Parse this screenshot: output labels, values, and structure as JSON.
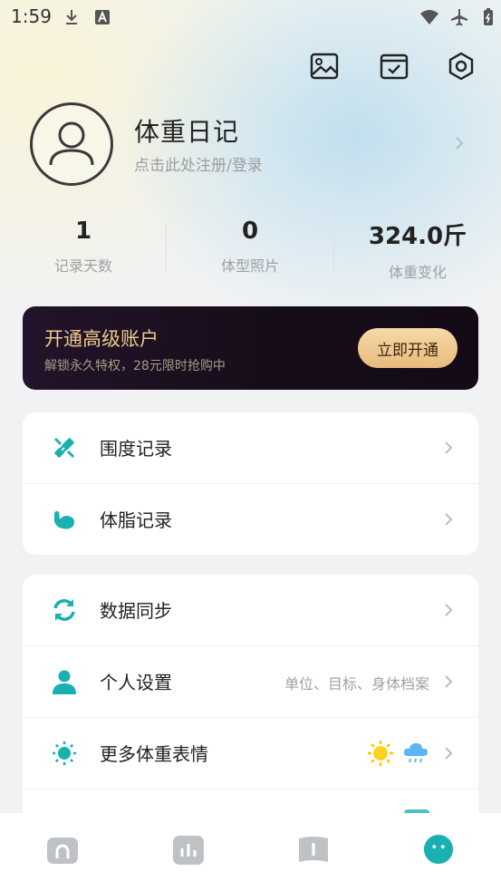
{
  "status": {
    "time": "1:59"
  },
  "profile": {
    "name": "体重日记",
    "subtitle": "点击此处注册/登录"
  },
  "stats": [
    {
      "value": "1",
      "label": "记录天数"
    },
    {
      "value": "0",
      "label": "体型照片"
    },
    {
      "value": "324.0斤",
      "label": "体重变化"
    }
  ],
  "premium": {
    "title": "开通高级账户",
    "subtitle": "解锁永久特权，28元限时抢购中",
    "button": "立即开通"
  },
  "records": [
    {
      "label": "围度记录",
      "icon": "tape-ruler-icon"
    },
    {
      "label": "体脂记录",
      "icon": "muscle-arm-icon"
    }
  ],
  "settings": [
    {
      "label": "数据同步",
      "hint": "",
      "icon": "sync-icon"
    },
    {
      "label": "个人设置",
      "hint": "单位、目标、身体档案",
      "icon": "person-icon"
    },
    {
      "label": "更多体重表情",
      "hint": "",
      "icon": "sun-icon"
    }
  ],
  "colors": {
    "accent": "#1ab0b2",
    "premium_gold": "#f0c98b",
    "premium_bg": "#150c18"
  },
  "nav": [
    "home-icon",
    "stats-icon",
    "book-icon",
    "profile-face-icon"
  ]
}
